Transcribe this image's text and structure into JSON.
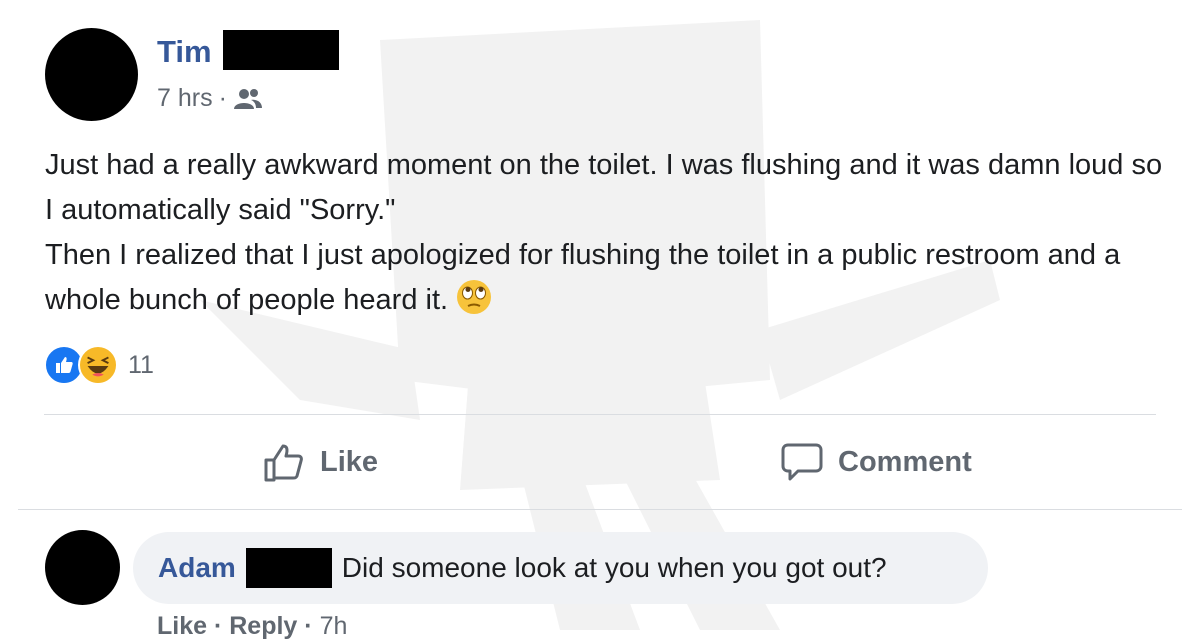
{
  "post": {
    "author_first_name": "Tim",
    "time": "7 hrs",
    "separator": "·",
    "audience_icon": "friends-icon",
    "text_line_1": "Just had a really awkward moment on the toilet. I was flushing and it was damn loud so I automatically said \"Sorry.\"",
    "text_line_2": "Then I realized that I just apologized for flushing the toilet in a public restroom and a whole bunch of people heard it.",
    "emoji": "face-with-rolling-eyes-icon"
  },
  "reactions": {
    "icons": [
      "like-reaction-icon",
      "haha-reaction-icon"
    ],
    "count": "11"
  },
  "actions": {
    "like_label": "Like",
    "comment_label": "Comment"
  },
  "comment": {
    "author_first_name": "Adam",
    "text": "Did someone look at you when you got out?",
    "like_label": "Like",
    "sep1": " · ",
    "reply_label": "Reply",
    "sep2": " · ",
    "time": "7h"
  },
  "colors": {
    "name_link": "#365899",
    "secondary_text": "#606770",
    "like_blue": "#1877f2",
    "haha_yellow": "#f7b928",
    "bubble_bg": "#f0f2f5"
  }
}
